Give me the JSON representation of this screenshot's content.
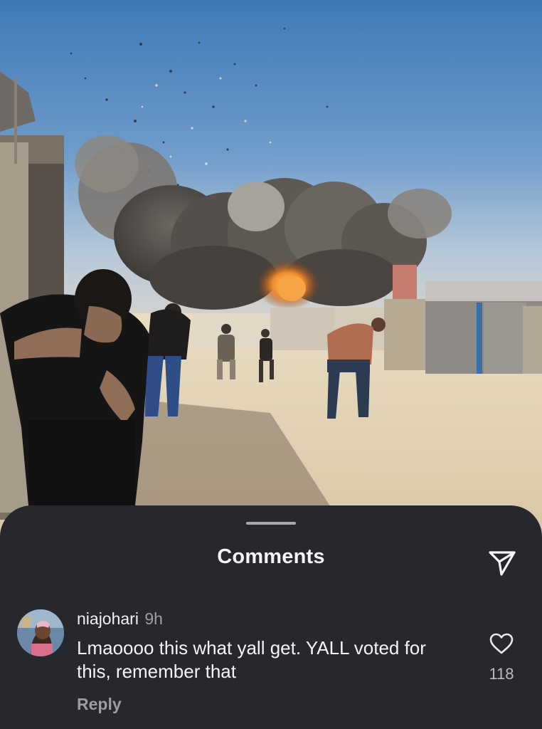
{
  "media": {
    "icon": "photo"
  },
  "sheet": {
    "title": "Comments",
    "share_icon": "share-send-icon"
  },
  "comment": {
    "username": "niajohari",
    "time": "9h",
    "text": "Lmaoooo this what yall get. YALL voted for this, remember that",
    "reply_label": "Reply",
    "like_count": "118",
    "like_icon": "heart-outline-icon"
  },
  "colors": {
    "sheet_bg": "#26282d",
    "text_primary": "#f4f4f4",
    "text_secondary": "#9c9ea3"
  }
}
